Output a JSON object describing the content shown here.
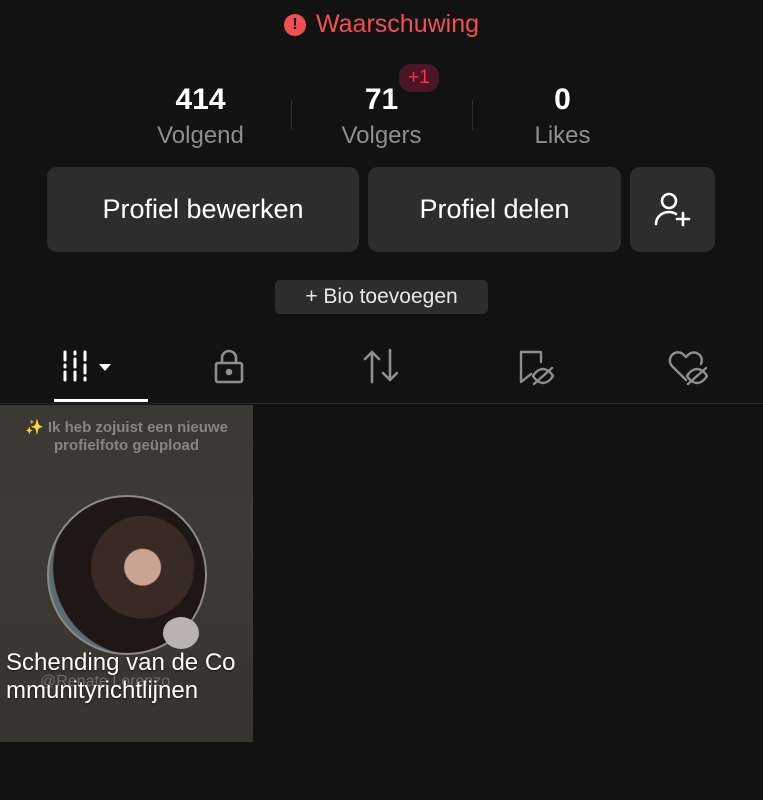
{
  "warning": {
    "text": "Waarschuwing",
    "icon": "exclamation-circle-icon",
    "color": "#f2504f"
  },
  "stats": [
    {
      "value": "414",
      "label": "Volgend"
    },
    {
      "value": "71",
      "label": "Volgers",
      "badge": "+1"
    },
    {
      "value": "0",
      "label": "Likes"
    }
  ],
  "actions": {
    "edit_label": "Profiel bewerken",
    "share_label": "Profiel delen",
    "add_friend_icon": "add-user-icon"
  },
  "bio": {
    "label": "+ Bio toevoegen"
  },
  "tabs": [
    {
      "name": "videos",
      "icon": "grid-filter-icon",
      "active": true
    },
    {
      "name": "private",
      "icon": "lock-icon"
    },
    {
      "name": "reposts",
      "icon": "repost-icon"
    },
    {
      "name": "saved",
      "icon": "bookmark-hidden-icon"
    },
    {
      "name": "liked",
      "icon": "heart-hidden-icon"
    }
  ],
  "videos": [
    {
      "thumb_text": "✨ Ik heb zojuist een nieuwe profielfoto geüpload",
      "watermark": "@Renate Lorenzo",
      "caption": "Schending van de Communityrichtlijnen"
    }
  ]
}
